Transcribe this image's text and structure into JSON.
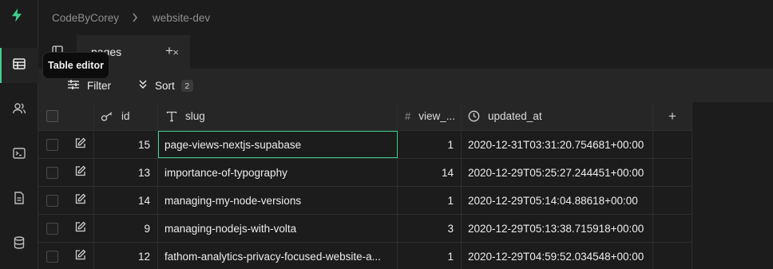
{
  "breadcrumb": {
    "org": "CodeByCorey",
    "project": "website-dev"
  },
  "tabs": [
    {
      "label": "pages",
      "close": "×"
    }
  ],
  "tab_add": "+",
  "tooltip": "Table editor",
  "toolbar": {
    "filter_label": "Filter",
    "sort_label": "Sort",
    "sort_count": "2"
  },
  "columns": {
    "id": "id",
    "slug": "slug",
    "view_count": "view_...",
    "updated_at": "updated_at",
    "add": "+"
  },
  "rows": [
    {
      "id": "15",
      "slug": "page-views-nextjs-supabase",
      "view_count": "1",
      "updated_at": "2020-12-31T03:31:20.754681+00:00"
    },
    {
      "id": "13",
      "slug": "importance-of-typography",
      "view_count": "14",
      "updated_at": "2020-12-29T05:25:27.244451+00:00"
    },
    {
      "id": "14",
      "slug": "managing-my-node-versions",
      "view_count": "1",
      "updated_at": "2020-12-29T05:14:04.88618+00:00"
    },
    {
      "id": "9",
      "slug": "managing-nodejs-with-volta",
      "view_count": "3",
      "updated_at": "2020-12-29T05:13:38.715918+00:00"
    },
    {
      "id": "12",
      "slug": "fathom-analytics-privacy-focused-website-a...",
      "view_count": "1",
      "updated_at": "2020-12-29T04:59:52.034548+00:00"
    }
  ],
  "colors": {
    "accent": "#3ecf8e",
    "background": "#1c1c1c",
    "panel": "#262626",
    "border": "#2e2e2e"
  },
  "icons": [
    "bolt-logo",
    "table-icon",
    "users-icon",
    "terminal-icon",
    "document-icon",
    "database-icon",
    "grid-icon",
    "filter-icon",
    "sort-icon",
    "key-icon",
    "text-type-icon",
    "clock-icon",
    "edit-icon",
    "chevron-right-icon"
  ]
}
